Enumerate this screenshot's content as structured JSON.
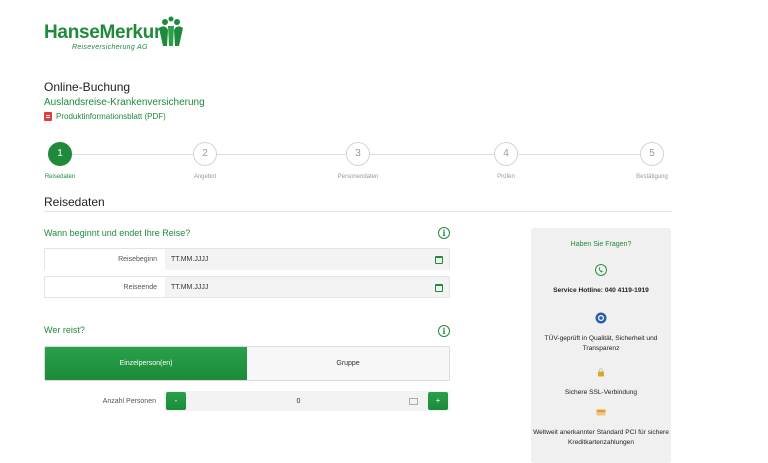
{
  "brand": {
    "name": "HanseMerkur",
    "tagline": "Reiseversicherung AG"
  },
  "header": {
    "title": "Online-Buchung",
    "product": "Auslandsreise-Krankenversicherung",
    "pdf_link": "Produktinformationsblatt (PDF)"
  },
  "steps": [
    {
      "number": "1",
      "label": "Reisedaten",
      "active": true
    },
    {
      "number": "2",
      "label": "Angebot",
      "active": false
    },
    {
      "number": "3",
      "label": "Personendaten",
      "active": false
    },
    {
      "number": "4",
      "label": "Prüfen",
      "active": false
    },
    {
      "number": "5",
      "label": "Bestätigung",
      "active": false
    }
  ],
  "section_title": "Reisedaten",
  "travel_dates": {
    "question": "Wann beginnt und endet Ihre Reise?",
    "info": "i",
    "start_label": "Reisebeginn",
    "start_value": "TT.MM.JJJJ",
    "end_label": "Reiseende",
    "end_value": "TT.MM.JJJJ"
  },
  "travellers": {
    "question": "Wer reist?",
    "info": "i",
    "option_single": "Einzelperson(en)",
    "option_group": "Gruppe",
    "selected": "Einzelperson(en)",
    "count_label": "Anzahl Personen",
    "minus": "-",
    "count_value": "0",
    "plus": "+"
  },
  "sidebar": {
    "title": "Haben Sie Fragen?",
    "hotline": "Service Hotline: 040 4119-1919",
    "tuev": "TÜV-geprüft in Qualität, Sicherheit und Transparenz",
    "ssl": "Sichere SSL-Verbindung",
    "pci": "Weltweit anerkannter Standard PCI für sichere Kreditkartenzahlungen"
  },
  "colors": {
    "brand_green": "#1f8a3b",
    "panel_grey": "#f0f0f0"
  }
}
